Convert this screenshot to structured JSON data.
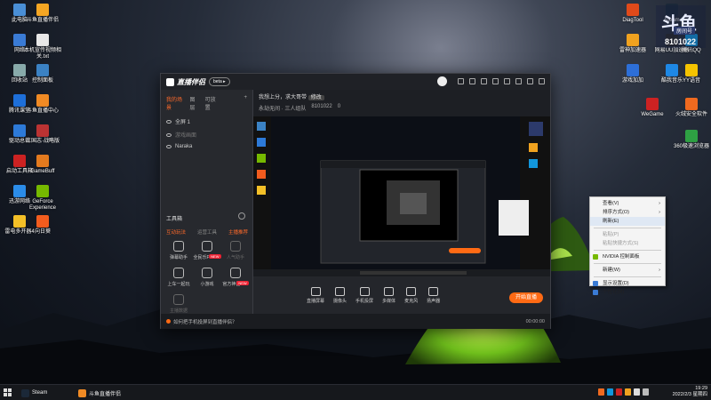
{
  "desktop": {
    "left_icons": [
      {
        "label": "此电脑",
        "color": "#4a8fd6"
      },
      {
        "label": "斗鱼直播伴侣",
        "color": "#f5a623"
      },
      {
        "label": "网络",
        "color": "#3a7bd5"
      },
      {
        "label": "本机宣传视频相关.txt",
        "color": "#e8e8e8"
      },
      {
        "label": "回收站",
        "color": "#8aa"
      },
      {
        "label": "控制面板",
        "color": "#3b82c4"
      },
      {
        "label": "腾讯课堂",
        "color": "#1e6fd9"
      },
      {
        "label": "斗鱼直播中心",
        "color": "#f08a24"
      },
      {
        "label": "驱动总裁",
        "color": "#2d7ad8"
      },
      {
        "label": "三国志·战略版",
        "color": "#b33"
      },
      {
        "label": "启动工具箱",
        "color": "#c22"
      },
      {
        "label": "GameBuff",
        "color": "#e37a1e"
      },
      {
        "label": "迅游网络",
        "color": "#2b8ce8"
      },
      {
        "label": "GeForce Experience",
        "color": "#76b900"
      },
      {
        "label": "雷电多开器4",
        "color": "#f4c027"
      },
      {
        "label": "向日葵",
        "color": "#f25c1e"
      }
    ],
    "right_icons": [
      {
        "label": "DiagTool",
        "color": "#e04a1a"
      },
      {
        "label": "Steam",
        "color": "#1b2838"
      },
      {
        "label": "雷神加速器",
        "color": "#f0a21f"
      },
      {
        "label": "网易UU加速器",
        "color": "#2a2a2a"
      },
      {
        "label": "腾讯QQ",
        "color": "#1296db"
      },
      {
        "label": "游戏加加",
        "color": "#2d6fd8"
      },
      {
        "label": "酷我音乐",
        "color": "#1e88e5"
      },
      {
        "label": "YY语音",
        "color": "#f5c400"
      },
      {
        "label": "WeGame",
        "color": "#c22"
      },
      {
        "label": "火绒安全软件",
        "color": "#f06a1f"
      },
      {
        "label": "360极速浏览器",
        "color": "#2ea043"
      }
    ]
  },
  "overlay": {
    "big": "斗鱼",
    "tag": "房间号",
    "room": "8101022"
  },
  "app": {
    "title": "直播伴侣",
    "version_pill": "beta ▸",
    "left_tabs": [
      "我的场景",
      "图层",
      "可放置"
    ],
    "scenes": [
      {
        "label": "全屏 1",
        "dim": false
      },
      {
        "label": "游戏画面",
        "dim": true
      },
      {
        "label": "Naraka",
        "dim": false
      }
    ],
    "toolbox_title": "工具箱",
    "toolbox_subtabs": [
      "互动玩法",
      "运营工具",
      "主播推荐"
    ],
    "tools": [
      {
        "label": "弹幕助手",
        "badge": "",
        "dim": false
      },
      {
        "label": "全民乐PK",
        "badge": "NEW",
        "dim": false
      },
      {
        "label": "人气助手",
        "badge": "",
        "dim": true
      },
      {
        "label": "上车一起玩",
        "badge": "",
        "dim": false
      },
      {
        "label": "小游戏",
        "badge": "",
        "dim": false
      },
      {
        "label": "官方神器",
        "badge": "NEW",
        "dim": false
      },
      {
        "label": "主播数据",
        "badge": "",
        "dim": true
      }
    ],
    "room_title": "我想上分，求大哥带",
    "room_title_tag": "修改",
    "room_meta": [
      "永劫无间 · 三人组队",
      "8101022",
      "0"
    ],
    "bottom_buttons": [
      "直播屏幕",
      "摄像头",
      "手机投屏",
      "多媒体",
      "麦克风",
      "扬声器"
    ],
    "live_button": "开始直播",
    "status_text": "如何把手机投屏到直播伴侣？",
    "status_time": "00:00:00"
  },
  "context_menu": {
    "items": [
      {
        "label": "查看(V)",
        "arrow": true,
        "disabled": false,
        "highlight": false,
        "icon": ""
      },
      {
        "label": "排序方式(O)",
        "arrow": true,
        "disabled": false,
        "highlight": false,
        "icon": ""
      },
      {
        "label": "刷新(E)",
        "arrow": false,
        "disabled": false,
        "highlight": true,
        "icon": ""
      },
      {
        "sep": true
      },
      {
        "label": "粘贴(P)",
        "arrow": false,
        "disabled": true,
        "highlight": false,
        "icon": ""
      },
      {
        "label": "粘贴快捷方式(S)",
        "arrow": false,
        "disabled": true,
        "highlight": false,
        "icon": ""
      },
      {
        "sep": true
      },
      {
        "label": "NVIDIA 控制面板",
        "arrow": false,
        "disabled": false,
        "highlight": false,
        "icon": "#76b900"
      },
      {
        "sep": true
      },
      {
        "label": "新建(W)",
        "arrow": true,
        "disabled": false,
        "highlight": false,
        "icon": ""
      },
      {
        "sep": true
      },
      {
        "label": "显示设置(D)",
        "arrow": false,
        "disabled": false,
        "highlight": false,
        "icon": "#3a7bd5"
      },
      {
        "label": "个性化(R)",
        "arrow": false,
        "disabled": false,
        "highlight": false,
        "icon": "#3a7bd5"
      }
    ]
  },
  "taskbar": {
    "tasks": [
      {
        "label": "Steam",
        "color": "#1b2838"
      },
      {
        "label": "斗鱼直播伴侣",
        "color": "#f08a24"
      }
    ],
    "time": "19:29",
    "date": "2022/2/3 星期四"
  }
}
